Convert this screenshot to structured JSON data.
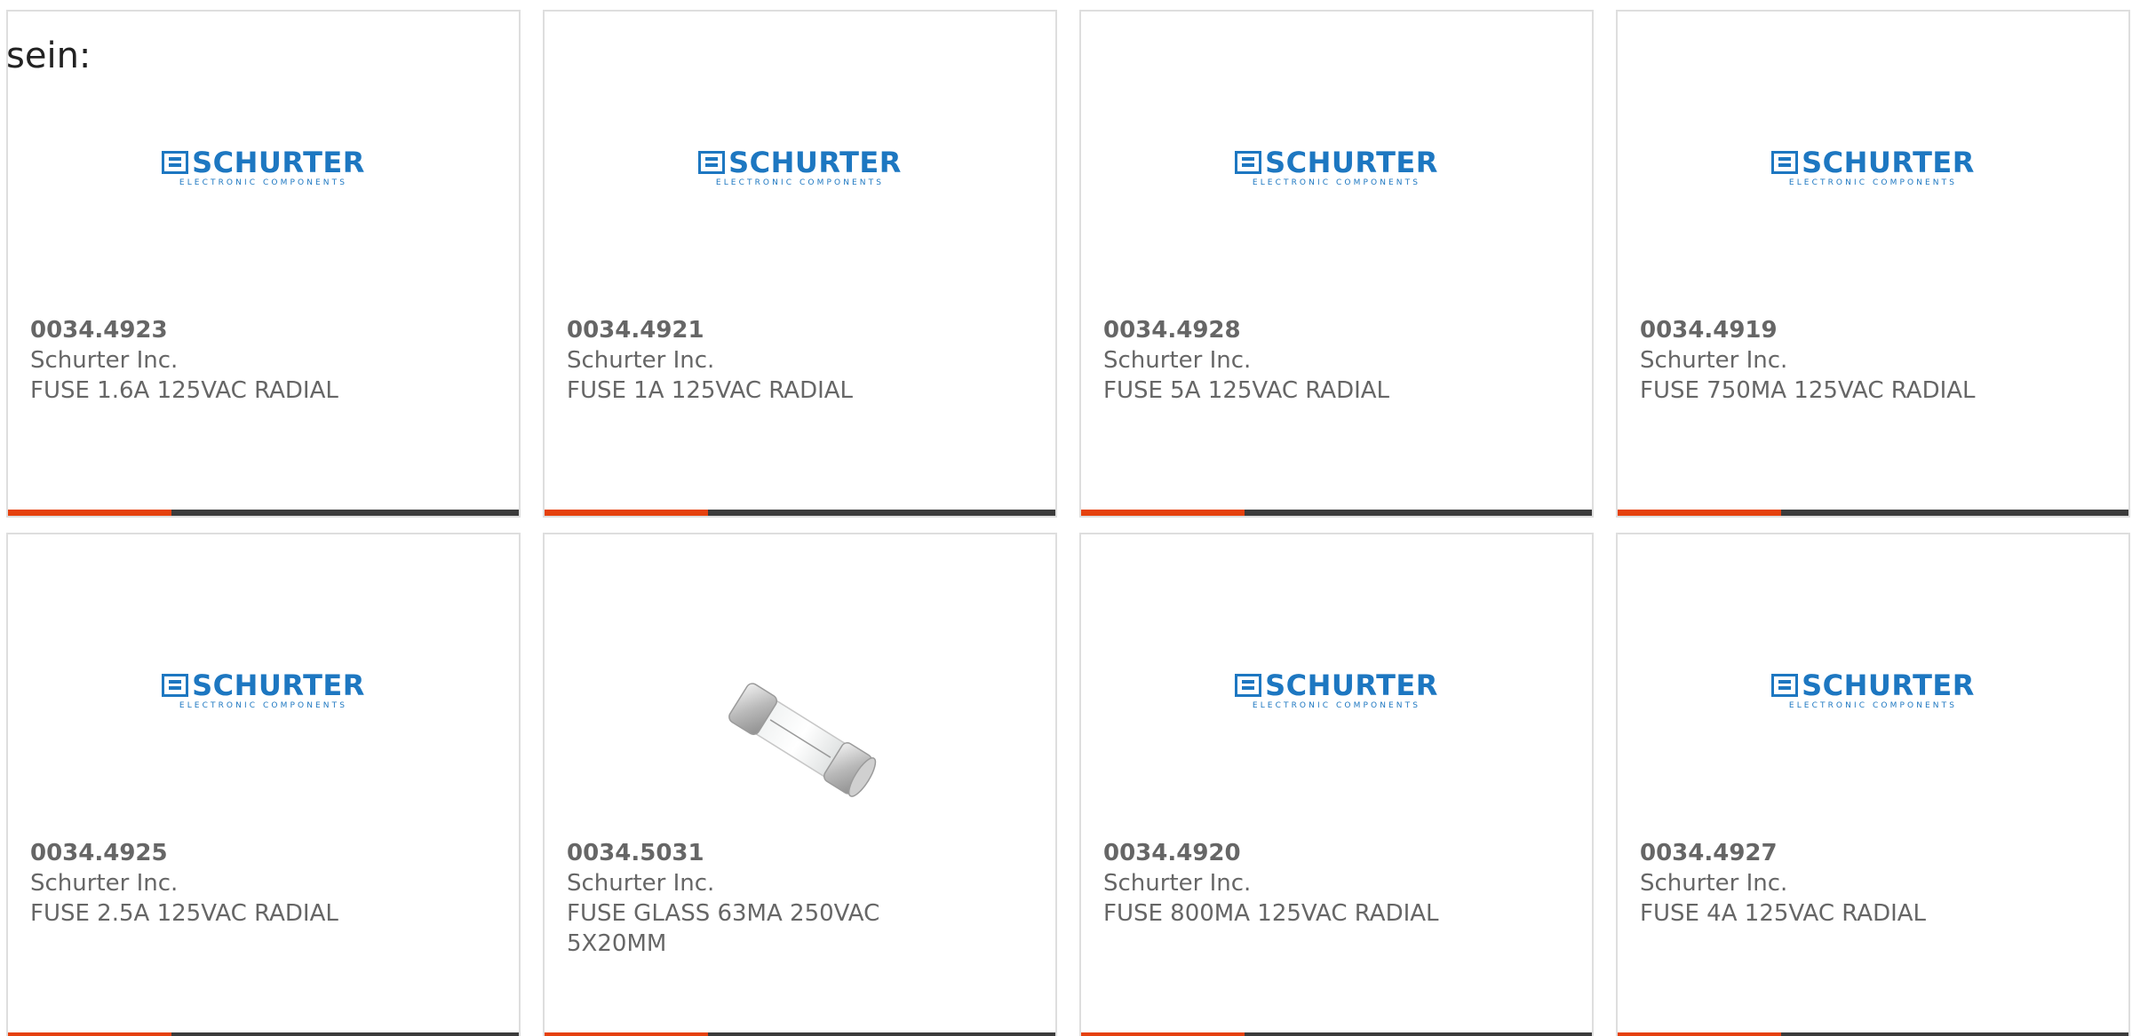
{
  "intro_text": "sein:",
  "logo": {
    "word": "SCHURTER",
    "sub": "ELECTRONIC COMPONENTS"
  },
  "colors": {
    "accent": "#e5410d",
    "bar": "#3b3b3b",
    "brand": "#1d77c1"
  },
  "products": [
    {
      "part_number": "0034.4923",
      "manufacturer": "Schurter Inc.",
      "description": "FUSE 1.6A 125VAC RADIAL",
      "image": "schurter-logo"
    },
    {
      "part_number": "0034.4921",
      "manufacturer": "Schurter Inc.",
      "description": "FUSE 1A 125VAC RADIAL",
      "image": "schurter-logo"
    },
    {
      "part_number": "0034.4928",
      "manufacturer": "Schurter Inc.",
      "description": "FUSE 5A 125VAC RADIAL",
      "image": "schurter-logo"
    },
    {
      "part_number": "0034.4919",
      "manufacturer": "Schurter Inc.",
      "description": "FUSE 750MA 125VAC RADIAL",
      "image": "schurter-logo"
    },
    {
      "part_number": "0034.4925",
      "manufacturer": "Schurter Inc.",
      "description": "FUSE 2.5A 125VAC RADIAL",
      "image": "schurter-logo"
    },
    {
      "part_number": "0034.5031",
      "manufacturer": "Schurter Inc.",
      "description": "FUSE GLASS 63MA 250VAC 5X20MM",
      "image": "glass-fuse-photo"
    },
    {
      "part_number": "0034.4920",
      "manufacturer": "Schurter Inc.",
      "description": "FUSE 800MA 125VAC RADIAL",
      "image": "schurter-logo"
    },
    {
      "part_number": "0034.4927",
      "manufacturer": "Schurter Inc.",
      "description": "FUSE 4A 125VAC RADIAL",
      "image": "schurter-logo"
    }
  ]
}
